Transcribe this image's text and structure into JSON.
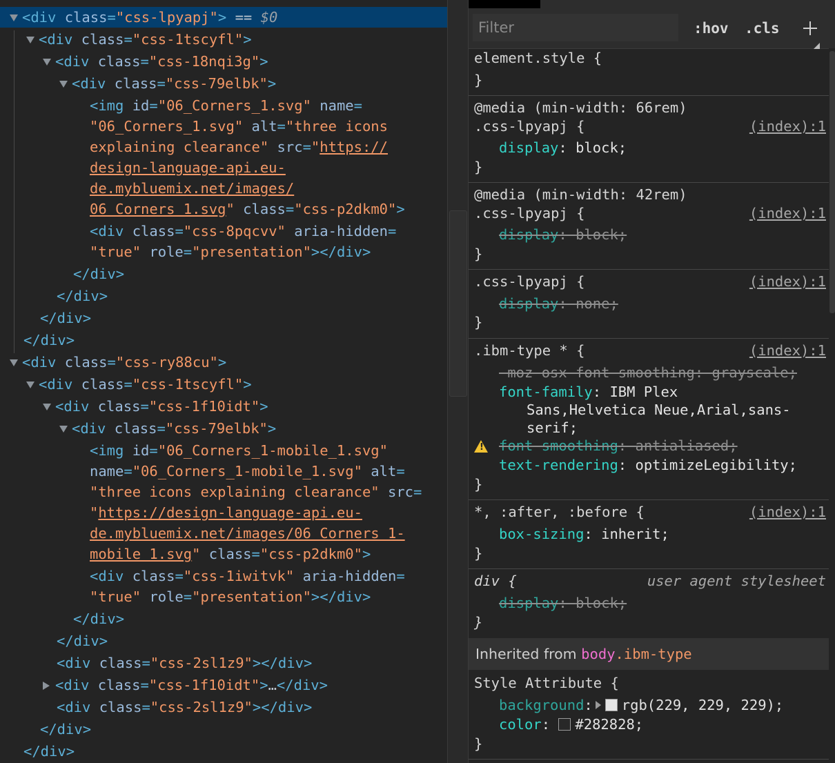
{
  "elements": {
    "lines": [
      {
        "html_parts": [
          [
            "tag",
            "<div "
          ],
          [
            "attr",
            "class"
          ],
          [
            "tag",
            "="
          ],
          [
            "val",
            "\"css-lpyapj\""
          ],
          [
            "tag",
            ">"
          ],
          [
            "eq",
            " == "
          ],
          [
            "dollar",
            "$0"
          ]
        ]
      },
      {
        "html_parts": [
          [
            "tag",
            "<div "
          ],
          [
            "attr",
            "class"
          ],
          [
            "tag",
            "="
          ],
          [
            "val",
            "\"css-1tscyfl\""
          ],
          [
            "tag",
            ">"
          ]
        ]
      },
      {
        "html_parts": [
          [
            "tag",
            "<div "
          ],
          [
            "attr",
            "class"
          ],
          [
            "tag",
            "="
          ],
          [
            "val",
            "\"css-18nqi3g\""
          ],
          [
            "tag",
            ">"
          ]
        ]
      },
      {
        "html_parts": [
          [
            "tag",
            "<div "
          ],
          [
            "attr",
            "class"
          ],
          [
            "tag",
            "="
          ],
          [
            "val",
            "\"css-79elbk\""
          ],
          [
            "tag",
            ">"
          ]
        ]
      },
      {
        "html_parts": [
          [
            "tag",
            "<img "
          ],
          [
            "attr",
            "id"
          ],
          [
            "tag",
            "="
          ],
          [
            "val",
            "\"06_Corners_1.svg\""
          ],
          [
            "attr",
            " name"
          ],
          [
            "tag",
            "="
          ]
        ]
      },
      {
        "html_parts": [
          [
            "val",
            "\"06_Corners_1.svg\""
          ],
          [
            "attr",
            " alt"
          ],
          [
            "tag",
            "="
          ],
          [
            "val",
            "\"three icons"
          ]
        ]
      },
      {
        "html_parts": [
          [
            "val",
            "explaining clearance\""
          ],
          [
            "attr",
            " src"
          ],
          [
            "tag",
            "="
          ],
          [
            "val",
            "\""
          ],
          [
            "link",
            "https://"
          ]
        ]
      },
      {
        "html_parts": [
          [
            "link",
            "design-language-api.eu-"
          ]
        ]
      },
      {
        "html_parts": [
          [
            "link",
            "de.mybluemix.net/images/"
          ]
        ]
      },
      {
        "html_parts": [
          [
            "link",
            "06 Corners 1.svg"
          ],
          [
            "val",
            "\""
          ],
          [
            "attr",
            " class"
          ],
          [
            "tag",
            "="
          ],
          [
            "val",
            "\"css-p2dkm0\""
          ],
          [
            "tag",
            ">"
          ]
        ]
      },
      {
        "html_parts": [
          [
            "tag",
            "<div "
          ],
          [
            "attr",
            "class"
          ],
          [
            "tag",
            "="
          ],
          [
            "val",
            "\"css-8pqcvv\""
          ],
          [
            "attr",
            " aria-hidden"
          ],
          [
            "tag",
            "="
          ]
        ]
      },
      {
        "html_parts": [
          [
            "val",
            "\"true\""
          ],
          [
            "attr",
            " role"
          ],
          [
            "tag",
            "="
          ],
          [
            "val",
            "\"presentation\""
          ],
          [
            "tag",
            "></div>"
          ]
        ]
      },
      {
        "html_parts": [
          [
            "tag",
            "</div>"
          ]
        ]
      },
      {
        "html_parts": [
          [
            "tag",
            "</div>"
          ]
        ]
      },
      {
        "html_parts": [
          [
            "tag",
            "</div>"
          ]
        ]
      },
      {
        "html_parts": [
          [
            "tag",
            "</div>"
          ]
        ]
      },
      {
        "html_parts": [
          [
            "tag",
            "<div "
          ],
          [
            "attr",
            "class"
          ],
          [
            "tag",
            "="
          ],
          [
            "val",
            "\"css-ry88cu\""
          ],
          [
            "tag",
            ">"
          ]
        ]
      },
      {
        "html_parts": [
          [
            "tag",
            "<div "
          ],
          [
            "attr",
            "class"
          ],
          [
            "tag",
            "="
          ],
          [
            "val",
            "\"css-1tscyfl\""
          ],
          [
            "tag",
            ">"
          ]
        ]
      },
      {
        "html_parts": [
          [
            "tag",
            "<div "
          ],
          [
            "attr",
            "class"
          ],
          [
            "tag",
            "="
          ],
          [
            "val",
            "\"css-1f10idt\""
          ],
          [
            "tag",
            ">"
          ]
        ]
      },
      {
        "html_parts": [
          [
            "tag",
            "<div "
          ],
          [
            "attr",
            "class"
          ],
          [
            "tag",
            "="
          ],
          [
            "val",
            "\"css-79elbk\""
          ],
          [
            "tag",
            ">"
          ]
        ]
      },
      {
        "html_parts": [
          [
            "tag",
            "<img "
          ],
          [
            "attr",
            "id"
          ],
          [
            "tag",
            "="
          ],
          [
            "val",
            "\"06_Corners_1-mobile_1.svg\""
          ]
        ]
      },
      {
        "html_parts": [
          [
            "attr",
            "name"
          ],
          [
            "tag",
            "="
          ],
          [
            "val",
            "\"06_Corners_1-mobile_1.svg\""
          ],
          [
            "attr",
            " alt"
          ],
          [
            "tag",
            "="
          ]
        ]
      },
      {
        "html_parts": [
          [
            "val",
            "\"three icons explaining clearance\""
          ],
          [
            "attr",
            " src"
          ],
          [
            "tag",
            "="
          ]
        ]
      },
      {
        "html_parts": [
          [
            "val",
            "\""
          ],
          [
            "link",
            "https://design-language-api.eu-"
          ]
        ]
      },
      {
        "html_parts": [
          [
            "link",
            "de.mybluemix.net/images/06 Corners 1-"
          ]
        ]
      },
      {
        "html_parts": [
          [
            "link",
            "mobile 1.svg"
          ],
          [
            "val",
            "\""
          ],
          [
            "attr",
            " class"
          ],
          [
            "tag",
            "="
          ],
          [
            "val",
            "\"css-p2dkm0\""
          ],
          [
            "tag",
            ">"
          ]
        ]
      },
      {
        "html_parts": [
          [
            "tag",
            "<div "
          ],
          [
            "attr",
            "class"
          ],
          [
            "tag",
            "="
          ],
          [
            "val",
            "\"css-1iwitvk\""
          ],
          [
            "attr",
            " aria-hidden"
          ],
          [
            "tag",
            "="
          ]
        ]
      },
      {
        "html_parts": [
          [
            "val",
            "\"true\""
          ],
          [
            "attr",
            " role"
          ],
          [
            "tag",
            "="
          ],
          [
            "val",
            "\"presentation\""
          ],
          [
            "tag",
            "></div>"
          ]
        ]
      },
      {
        "html_parts": [
          [
            "tag",
            "</div>"
          ]
        ]
      },
      {
        "html_parts": [
          [
            "tag",
            "</div>"
          ]
        ]
      },
      {
        "html_parts": [
          [
            "tag",
            "<div "
          ],
          [
            "attr",
            "class"
          ],
          [
            "tag",
            "="
          ],
          [
            "val",
            "\"css-2sl1z9\""
          ],
          [
            "tag",
            "></div>"
          ]
        ]
      },
      {
        "html_parts": [
          [
            "tag",
            "<div "
          ],
          [
            "attr",
            "class"
          ],
          [
            "tag",
            "="
          ],
          [
            "val",
            "\"css-1f10idt\""
          ],
          [
            "tag",
            ">"
          ],
          [
            "eq",
            "…"
          ],
          [
            "tag",
            "</div>"
          ]
        ]
      },
      {
        "html_parts": [
          [
            "tag",
            "<div "
          ],
          [
            "attr",
            "class"
          ],
          [
            "tag",
            "="
          ],
          [
            "val",
            "\"css-2sl1z9\""
          ],
          [
            "tag",
            "></div>"
          ]
        ]
      },
      {
        "html_parts": [
          [
            "tag",
            "</div>"
          ]
        ]
      },
      {
        "html_parts": [
          [
            "tag",
            "</div>"
          ]
        ]
      }
    ]
  },
  "styles": {
    "filter_placeholder": "Filter",
    "hov_label": ":hov",
    "cls_label": ".cls",
    "rules": {
      "element_style": {
        "selector": "element.style {",
        "close": "}"
      },
      "media1": {
        "media": "@media (min-width: 66rem)",
        "selector": ".css-lpyapj {",
        "source": "(index):1",
        "prop": "display",
        "value": "block;",
        "close": "}"
      },
      "media2": {
        "media": "@media (min-width: 42rem)",
        "selector": ".css-lpyapj {",
        "source": "(index):1",
        "prop": "display",
        "value": "block;",
        "close": "}"
      },
      "base": {
        "selector": ".css-lpyapj {",
        "source": "(index):1",
        "prop": "display",
        "value": "none;",
        "close": "}"
      },
      "ibm": {
        "selector": ".ibm-type * {",
        "source": "(index):1",
        "p1": "-moz-osx-font-smoothing: grayscale;",
        "p2_prop": "font-family",
        "p2_val": "IBM Plex",
        "p2_val2": "Sans,Helvetica Neue,Arial,sans-",
        "p2_val3": "serif;",
        "p3_prop": "font-smoothing",
        "p3_val": "antialiased;",
        "p4_prop": "text-rendering",
        "p4_val": "optimizeLegibility;",
        "close": "}"
      },
      "universal": {
        "selector": "*, :after, :before {",
        "source": "(index):1",
        "prop": "box-sizing",
        "value": "inherit;",
        "close": "}"
      },
      "ua_div": {
        "selector": "div {",
        "source": "user agent stylesheet",
        "prop": "display",
        "value": "block;",
        "close": "}"
      }
    },
    "inherited": {
      "prefix": "Inherited from ",
      "selector": "body",
      "cls": ".ibm-type"
    },
    "style_attr": {
      "header": "Style Attribute {",
      "bg_prop": "background",
      "bg_val": "rgb(229, 229, 229);",
      "color_prop": "color",
      "color_val": "#282828;",
      "close": "}"
    },
    "colors": {
      "bg_swatch": "#e5e5e5",
      "color_swatch": "#282828"
    }
  }
}
